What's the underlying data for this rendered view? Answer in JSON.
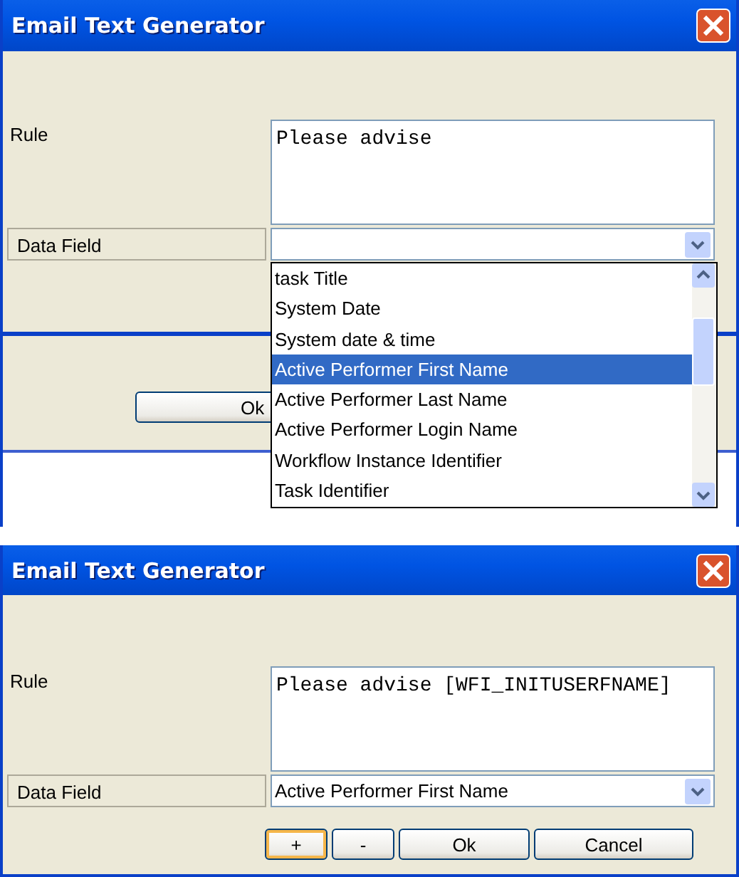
{
  "top_dialog": {
    "title": "Email Text Generator",
    "rule_label": "Rule",
    "rule_text": "Please advise",
    "data_field_label": "Data Field",
    "ok_button": "Ok",
    "dropdown_list": {
      "items": [
        {
          "label": "task Title",
          "selected": false
        },
        {
          "label": "System Date",
          "selected": false
        },
        {
          "label": "System date & time",
          "selected": false
        },
        {
          "label": "Active Performer First Name",
          "selected": true
        },
        {
          "label": "Active Performer Last Name",
          "selected": false
        },
        {
          "label": "Active Performer Login Name",
          "selected": false
        },
        {
          "label": "Workflow Instance Identifier",
          "selected": false
        },
        {
          "label": "Task Identifier",
          "selected": false
        }
      ]
    }
  },
  "bottom_dialog": {
    "title": "Email Text Generator",
    "rule_label": "Rule",
    "rule_text": "Please advise [WFI_INITUSERFNAME]",
    "data_field_label": "Data Field",
    "data_field_value": "Active Performer First Name",
    "buttons": [
      {
        "label": "+",
        "focused": true
      },
      {
        "label": "-",
        "focused": false
      },
      {
        "label": "Ok",
        "focused": false
      },
      {
        "label": "Cancel",
        "focused": false
      }
    ]
  }
}
